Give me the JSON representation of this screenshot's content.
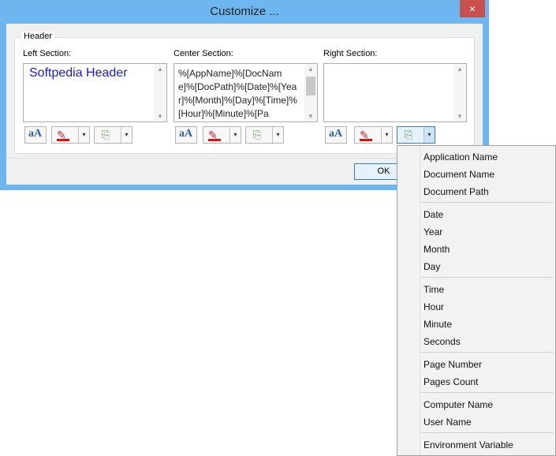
{
  "window": {
    "title": "Customize ..."
  },
  "dialog": {
    "group_label": "Header",
    "sections": {
      "left": {
        "label": "Left Section:",
        "text": "Softpedia Header"
      },
      "center": {
        "label": "Center Section:",
        "text": "%[AppName]%[DocName]%[DocPath]%[Date]%[Year]%[Month]%[Day]%[Time]%[Hour]%[Minute]%[Pa"
      },
      "right": {
        "label": "Right Section:",
        "text": ""
      }
    },
    "ok_label": "OK"
  },
  "icons": {
    "close": "×",
    "font": "aA",
    "color": "✎",
    "insert": "⎘",
    "dropdown": "▾",
    "scroll_up": "▲",
    "scroll_down": "▼"
  },
  "colors": {
    "title_bar": "#6eb6ef",
    "close_button": "#c7504c",
    "header_text": "#1a1ad9"
  },
  "menu": {
    "groups": [
      [
        "Application Name",
        "Document Name",
        "Document Path"
      ],
      [
        "Date",
        "Year",
        "Month",
        "Day"
      ],
      [
        "Time",
        "Hour",
        "Minute",
        "Seconds"
      ],
      [
        "Page Number",
        "Pages Count"
      ],
      [
        "Computer Name",
        "User Name"
      ],
      [
        "Environment Variable"
      ]
    ]
  }
}
